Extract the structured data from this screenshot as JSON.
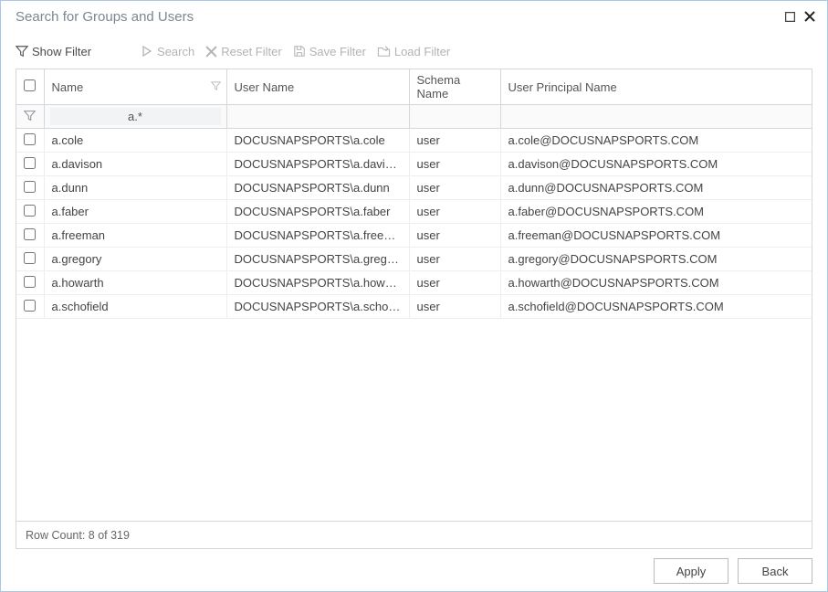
{
  "window": {
    "title": "Search for Groups and Users"
  },
  "toolbar": {
    "show_filter": "Show Filter",
    "search": "Search",
    "reset_filter": "Reset Filter",
    "save_filter": "Save Filter",
    "load_filter": "Load Filter"
  },
  "columns": {
    "name": "Name",
    "user_name": "User Name",
    "schema_name": "Schema Name",
    "upn": "User Principal Name"
  },
  "filter": {
    "name_value": "a.*"
  },
  "rows": [
    {
      "name": "a.cole",
      "user": "DOCUSNAPSPORTS\\a.cole",
      "schema": "user",
      "upn": "a.cole@DOCUSNAPSPORTS.COM"
    },
    {
      "name": "a.davison",
      "user": "DOCUSNAPSPORTS\\a.davison",
      "schema": "user",
      "upn": "a.davison@DOCUSNAPSPORTS.COM"
    },
    {
      "name": "a.dunn",
      "user": "DOCUSNAPSPORTS\\a.dunn",
      "schema": "user",
      "upn": "a.dunn@DOCUSNAPSPORTS.COM"
    },
    {
      "name": "a.faber",
      "user": "DOCUSNAPSPORTS\\a.faber",
      "schema": "user",
      "upn": "a.faber@DOCUSNAPSPORTS.COM"
    },
    {
      "name": "a.freeman",
      "user": "DOCUSNAPSPORTS\\a.freeman",
      "schema": "user",
      "upn": "a.freeman@DOCUSNAPSPORTS.COM"
    },
    {
      "name": "a.gregory",
      "user": "DOCUSNAPSPORTS\\a.gregory",
      "schema": "user",
      "upn": "a.gregory@DOCUSNAPSPORTS.COM"
    },
    {
      "name": "a.howarth",
      "user": "DOCUSNAPSPORTS\\a.howarth",
      "schema": "user",
      "upn": "a.howarth@DOCUSNAPSPORTS.COM"
    },
    {
      "name": "a.schofield",
      "user": "DOCUSNAPSPORTS\\a.schofield",
      "schema": "user",
      "upn": "a.schofield@DOCUSNAPSPORTS.COM"
    }
  ],
  "status": {
    "row_count": "Row Count: 8 of 319"
  },
  "buttons": {
    "apply": "Apply",
    "back": "Back"
  }
}
